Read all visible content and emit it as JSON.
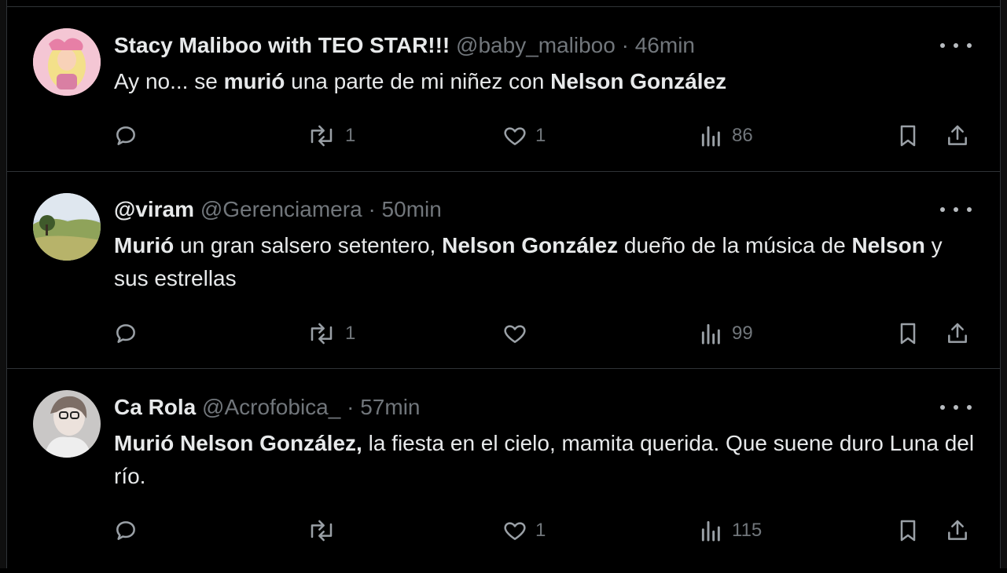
{
  "tweets": [
    {
      "name": "Stacy Maliboo with TEO STAR!!!",
      "handle": "@baby_maliboo",
      "dot": "·",
      "time": "46min",
      "text_segments": [
        {
          "t": "Ay no... se ",
          "b": false
        },
        {
          "t": "murió",
          "b": true
        },
        {
          "t": " una parte de mi niñez con ",
          "b": false
        },
        {
          "t": "Nelson González",
          "b": true
        }
      ],
      "replies": "",
      "retweets": "1",
      "likes": "1",
      "views": "86"
    },
    {
      "name": "@viram",
      "handle": "@Gerenciamera",
      "dot": "·",
      "time": "50min",
      "text_segments": [
        {
          "t": "Murió",
          "b": true
        },
        {
          "t": " un gran salsero setentero, ",
          "b": false
        },
        {
          "t": "Nelson González",
          "b": true
        },
        {
          "t": " dueño de la música de ",
          "b": false
        },
        {
          "t": "Nelson",
          "b": true
        },
        {
          "t": " y sus estrellas",
          "b": false
        }
      ],
      "replies": "",
      "retweets": "1",
      "likes": "",
      "views": "99"
    },
    {
      "name": "Ca Rola",
      "handle": "@Acrofobica_",
      "dot": "·",
      "time": "57min",
      "text_segments": [
        {
          "t": "Murió Nelson González,",
          "b": true
        },
        {
          "t": " la fiesta en el cielo, mamita querida. Que suene duro Luna del río.",
          "b": false
        }
      ],
      "replies": "",
      "retweets": "",
      "likes": "1",
      "views": "115"
    }
  ],
  "icons": {
    "reply": "reply-icon",
    "retweet": "retweet-icon",
    "like": "heart-icon",
    "views": "views-icon",
    "bookmark": "bookmark-icon",
    "share": "share-icon",
    "more": "more-icon"
  },
  "colors": {
    "background": "#000000",
    "text": "#e7e9ea",
    "secondary": "#71767b",
    "border": "#2f3336"
  }
}
